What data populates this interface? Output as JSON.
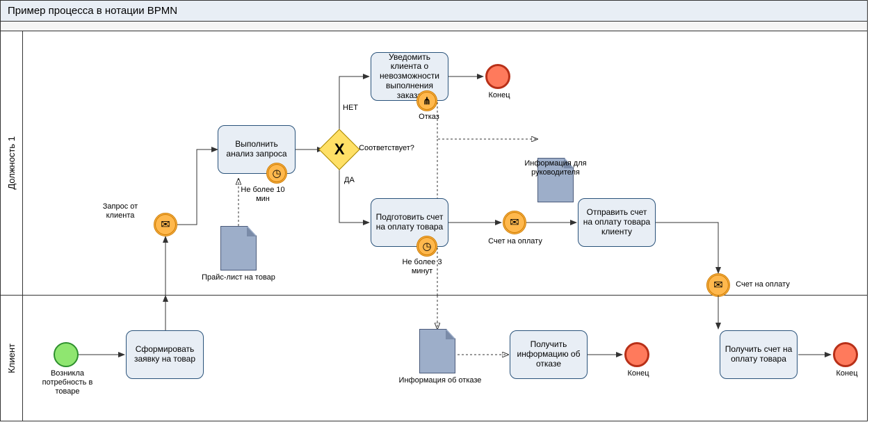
{
  "pool_title": "Пример процесса в нотации BPMN",
  "lanes": {
    "lane1_name": "Должность 1",
    "lane2_name": "Клиент"
  },
  "tasks": {
    "form_request": "Сформировать заявку на товар",
    "analyze": "Выполнить анализ запроса",
    "notify_impossible": "Уведомить клиента о невозможности выполнения заказа",
    "prepare_invoice": "Подготовить счет на оплату товара",
    "send_invoice": "Отправить счет на оплату товара клиенту",
    "receive_refusal": "Получить информацию об отказе",
    "receive_invoice": "Получить счет на оплату товара"
  },
  "events": {
    "start_label": "Возникла потребность в товаре",
    "request_from_client": "Запрос от клиента",
    "timer_analyze": "Не более 10 мин",
    "timer_prepare": "Не более 3 минут",
    "refusal_label": "Отказ",
    "invoice_label": "Счет на оплату",
    "invoice_msg_label": "Счет на оплату",
    "end_label": "Конец"
  },
  "gateway": {
    "question": "Соответствует?",
    "yes": "ДА",
    "no": "НЕТ"
  },
  "data_objects": {
    "price_list": "Прайс-лист на товар",
    "manager_info": "Информация для руководителя",
    "refusal_info": "Информация об отказе"
  },
  "icons": {
    "envelope": "✉",
    "clock": "◷",
    "compensate": "⋔"
  }
}
